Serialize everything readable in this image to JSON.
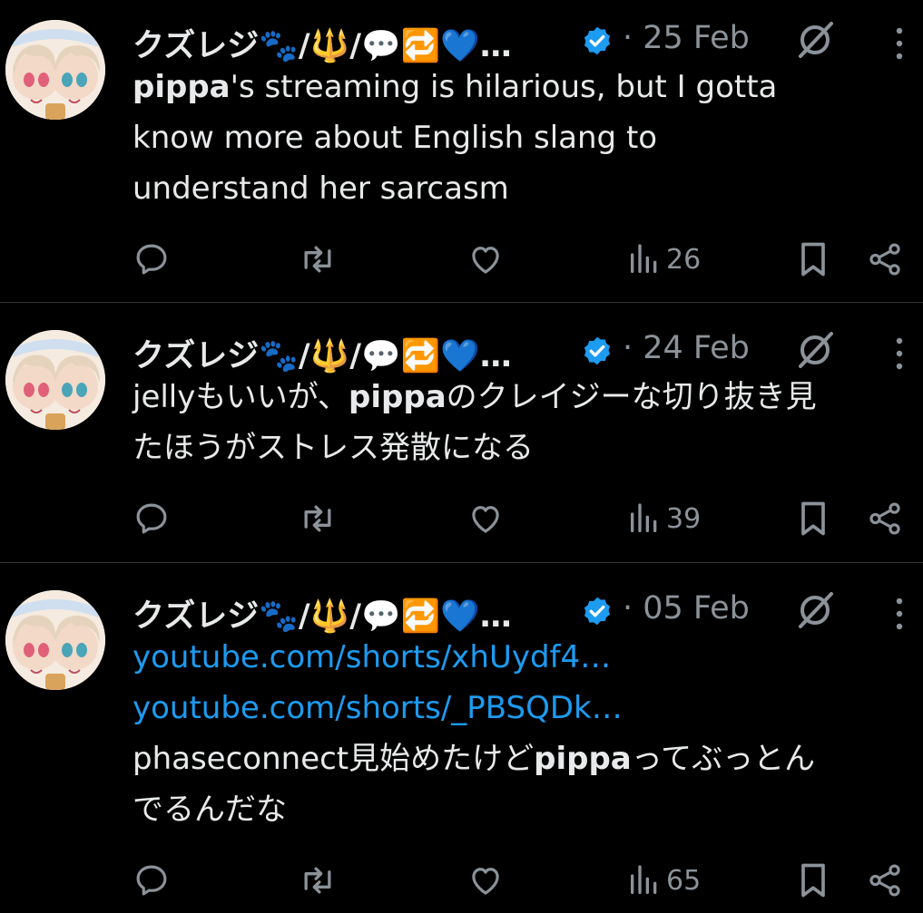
{
  "tweets": [
    {
      "author": "クズレジ🐾/🔱/💬🔁💙…",
      "date": "· 25 Feb",
      "text": [
        {
          "bold": true,
          "t": "pippa"
        },
        {
          "bold": false,
          "t": "'s streaming is hilarious, but I gotta\nknow more about English slang to\nunderstand her sarcasm"
        }
      ],
      "links": [],
      "views": "26"
    },
    {
      "author": "クズレジ🐾/🔱/💬🔁💙…",
      "date": "· 24 Feb",
      "text": [
        {
          "bold": false,
          "t": "jellyもいいが、"
        },
        {
          "bold": true,
          "t": "pippa"
        },
        {
          "bold": false,
          "t": "のクレイジーな切り抜き見\nたほうがストレス発散になる"
        }
      ],
      "links": [],
      "views": "39"
    },
    {
      "author": "クズレジ🐾/🔱/💬🔁💙…",
      "date": "· 05 Feb",
      "links": [
        "youtube.com/shorts/xhUydf4…",
        "youtube.com/shorts/_PBSQDk…"
      ],
      "text": [
        {
          "bold": false,
          "t": "phaseconnect見始めたけど"
        },
        {
          "bold": true,
          "t": "pippa"
        },
        {
          "bold": false,
          "t": "ってぶっとん\nでるんだな"
        }
      ],
      "views": "65"
    }
  ],
  "colors": {
    "background": "#000000",
    "text": "#e7e9ea",
    "muted": "#8b9299",
    "link": "#1d9bf0",
    "verified": "#1d9bf0",
    "divider": "#2f3336"
  },
  "icons": [
    "reply-icon",
    "retweet-icon",
    "like-icon",
    "views-icon",
    "bookmark-icon",
    "share-icon",
    "grok-icon",
    "more-icon",
    "verified-badge-icon"
  ]
}
